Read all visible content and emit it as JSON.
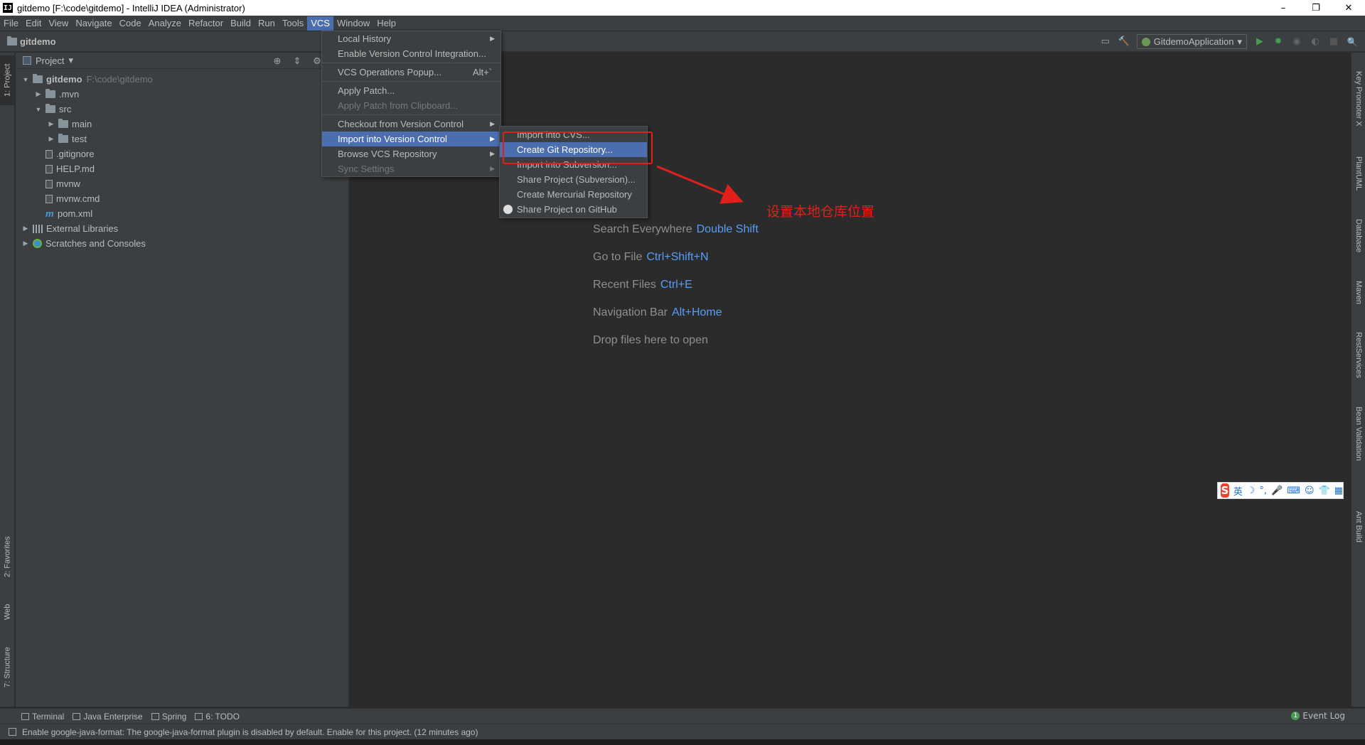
{
  "window": {
    "title": "gitdemo [F:\\code\\gitdemo] - IntelliJ IDEA (Administrator)",
    "app_icon": "IJ",
    "minimize": "–",
    "restore": "❐",
    "close": "✕"
  },
  "menubar": [
    "File",
    "Edit",
    "View",
    "Navigate",
    "Code",
    "Analyze",
    "Refactor",
    "Build",
    "Run",
    "Tools",
    "VCS",
    "Window",
    "Help"
  ],
  "breadcrumb": "gitdemo",
  "toolbar": {
    "run_config": "GitdemoApplication",
    "run_config_arrow": "▾",
    "icons": {
      "run": "▶",
      "debug": "✹",
      "coverage": "◉",
      "profile": "◐",
      "stop": "■",
      "search": "🔍",
      "layout": "▭",
      "build": "🔨"
    }
  },
  "project_panel": {
    "header_label": "Project",
    "header_arrow": "▾",
    "tools": {
      "locate": "⊕",
      "collapse": "⇕",
      "settings": "⚙"
    },
    "tree": [
      {
        "label": "gitdemo",
        "path": "F:\\code\\gitdemo",
        "arrow": "▼",
        "indent": 0,
        "type": "folder"
      },
      {
        "label": ".mvn",
        "path": "",
        "arrow": "▶",
        "indent": 1,
        "type": "folder"
      },
      {
        "label": "src",
        "path": "",
        "arrow": "▼",
        "indent": 1,
        "type": "folder"
      },
      {
        "label": "main",
        "path": "",
        "arrow": "▶",
        "indent": 2,
        "type": "folder"
      },
      {
        "label": "test",
        "path": "",
        "arrow": "▶",
        "indent": 2,
        "type": "folder"
      },
      {
        "label": ".gitignore",
        "path": "",
        "arrow": "",
        "indent": 1,
        "type": "file"
      },
      {
        "label": "HELP.md",
        "path": "",
        "arrow": "",
        "indent": 1,
        "type": "file"
      },
      {
        "label": "mvnw",
        "path": "",
        "arrow": "",
        "indent": 1,
        "type": "file"
      },
      {
        "label": "mvnw.cmd",
        "path": "",
        "arrow": "",
        "indent": 1,
        "type": "file"
      },
      {
        "label": "pom.xml",
        "path": "",
        "arrow": "",
        "indent": 1,
        "type": "maven"
      },
      {
        "label": "External Libraries",
        "path": "",
        "arrow": "▶",
        "indent": 0,
        "type": "lib"
      },
      {
        "label": "Scratches and Consoles",
        "path": "",
        "arrow": "▶",
        "indent": 0,
        "type": "scratch"
      }
    ]
  },
  "left_stripe": {
    "project": "1: Project",
    "favorites": "2: Favorites",
    "web": "Web",
    "structure": "7: Structure"
  },
  "right_stripe": [
    "Key Promoter X",
    "PlantUML",
    "Database",
    "Maven",
    "RestServices",
    "Bean Validation",
    "Ant Build"
  ],
  "vcs_menu": {
    "items": [
      {
        "label": "Local History",
        "submenu": true,
        "disabled": false,
        "selected": false,
        "shortcut": ""
      },
      {
        "label": "Enable Version Control Integration...",
        "submenu": false,
        "disabled": false,
        "selected": false,
        "shortcut": ""
      },
      {
        "sep": true
      },
      {
        "label": "VCS Operations Popup...",
        "submenu": false,
        "disabled": false,
        "selected": false,
        "shortcut": "Alt+`"
      },
      {
        "sep": true
      },
      {
        "label": "Apply Patch...",
        "submenu": false,
        "disabled": false,
        "selected": false,
        "shortcut": ""
      },
      {
        "label": "Apply Patch from Clipboard...",
        "submenu": false,
        "disabled": true,
        "selected": false,
        "shortcut": ""
      },
      {
        "sep": true
      },
      {
        "label": "Checkout from Version Control",
        "submenu": true,
        "disabled": false,
        "selected": false,
        "shortcut": ""
      },
      {
        "label": "Import into Version Control",
        "submenu": true,
        "disabled": false,
        "selected": true,
        "shortcut": ""
      },
      {
        "label": "Browse VCS Repository",
        "submenu": true,
        "disabled": false,
        "selected": false,
        "shortcut": ""
      },
      {
        "label": "Sync Settings",
        "submenu": true,
        "disabled": true,
        "selected": false,
        "shortcut": ""
      }
    ]
  },
  "import_submenu": {
    "items": [
      {
        "label": "Import into CVS...",
        "selected": false,
        "github": false
      },
      {
        "label": "Create Git Repository...",
        "selected": true,
        "github": false
      },
      {
        "label": "Import into Subversion...",
        "selected": false,
        "github": false
      },
      {
        "label": "Share Project (Subversion)...",
        "selected": false,
        "github": false
      },
      {
        "label": "Create Mercurial Repository",
        "selected": false,
        "github": false
      },
      {
        "label": "Share Project on GitHub",
        "selected": false,
        "github": true
      }
    ]
  },
  "annotation": {
    "text": "设置本地仓库位置",
    "color": "#e0201a"
  },
  "editor_hints": [
    {
      "label": "Search Everywhere",
      "key": "Double Shift"
    },
    {
      "label": "Go to File",
      "key": "Ctrl+Shift+N"
    },
    {
      "label": "Recent Files",
      "key": "Ctrl+E"
    },
    {
      "label": "Navigation Bar",
      "key": "Alt+Home"
    },
    {
      "label": "Drop files here to open",
      "key": ""
    }
  ],
  "bottom_tabs": [
    {
      "label": "Terminal"
    },
    {
      "label": "Java Enterprise"
    },
    {
      "label": "Spring"
    },
    {
      "label": "6: TODO"
    }
  ],
  "event_log": {
    "label": "Event Log",
    "count": "1"
  },
  "status": "Enable google-java-format: The google-java-format plugin is disabled by default. Enable for this project. (12 minutes ago)",
  "ime": {
    "logo": "S",
    "items": [
      "英",
      "☽",
      "°,",
      "🎤",
      "⌨",
      "☺",
      "👕",
      "▦"
    ]
  },
  "colors": {
    "accent": "#4b6eaf",
    "annotation": "#e0201a",
    "key_hint": "#589df6",
    "background": "#2b2b2b",
    "panel": "#3c3f41"
  }
}
